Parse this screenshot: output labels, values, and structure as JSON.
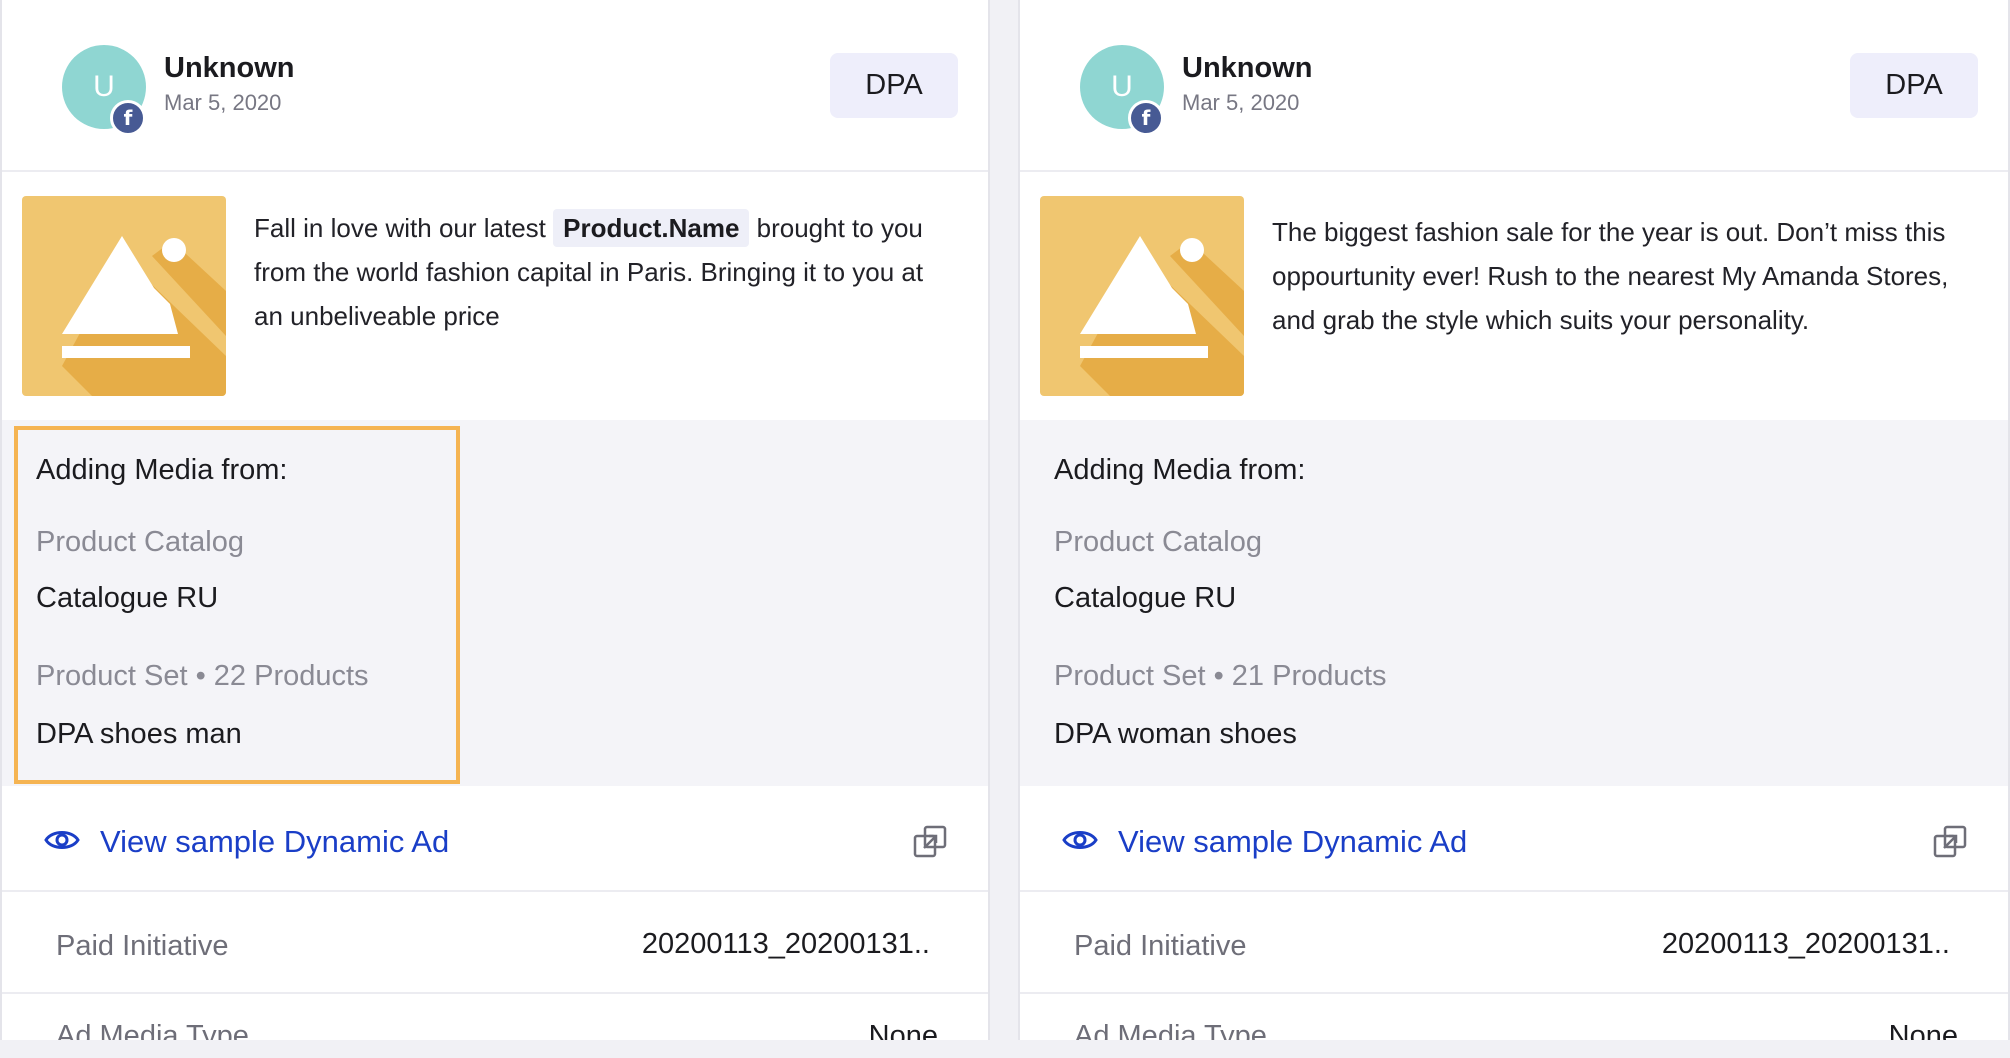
{
  "cards": [
    {
      "author": "Unknown",
      "avatar_initial": "U",
      "network_icon_letter": "f",
      "date": "Mar 5, 2020",
      "badge": "DPA",
      "ad_text_prefix": "Fall in love with our latest",
      "ad_token": "Product.Name",
      "ad_text_suffix": "brought to you from the world fashion capital in Paris. Bringing it to you at an unbeliveable price",
      "media": {
        "title": "Adding Media from:",
        "catalog_label": "Product Catalog",
        "catalog_value": "Catalogue RU",
        "set_label": "Product Set • 22 Products",
        "set_value": "DPA shoes man",
        "highlighted": true
      },
      "view_link": "View sample Dynamic Ad",
      "paid_initiative_label": "Paid Initiative",
      "paid_initiative_value": "20200113_20200131..",
      "media_type_label": "Ad Media Type",
      "media_type_value": "None"
    },
    {
      "author": "Unknown",
      "avatar_initial": "U",
      "network_icon_letter": "f",
      "date": "Mar 5, 2020",
      "badge": "DPA",
      "ad_text": "The biggest fashion sale for the year is out. Don’t miss this oppourtunity ever! Rush to the nearest My Amanda Stores, and grab the style which suits your personality.",
      "media": {
        "title": "Adding Media from:",
        "catalog_label": "Product Catalog",
        "catalog_value": "Catalogue RU",
        "set_label": "Product Set • 21 Products",
        "set_value": "DPA woman shoes",
        "highlighted": false
      },
      "view_link": "View sample Dynamic Ad",
      "paid_initiative_label": "Paid Initiative",
      "paid_initiative_value": "20200113_20200131..",
      "media_type_label": "Ad Media Type",
      "media_type_value": "None"
    }
  ],
  "colors": {
    "avatar": "#8fd6d2",
    "facebook": "#475a94",
    "badge_bg": "#eeeefb",
    "link": "#1a3ec7",
    "highlight_border": "#f5b452",
    "placeholder_bg": "#f0c670",
    "placeholder_shadow": "#e6ad47"
  },
  "icons": {
    "eye": "eye-icon",
    "open_external": "open-in-new-icon",
    "image_placeholder": "image-placeholder-icon",
    "social_network": "facebook-icon"
  }
}
